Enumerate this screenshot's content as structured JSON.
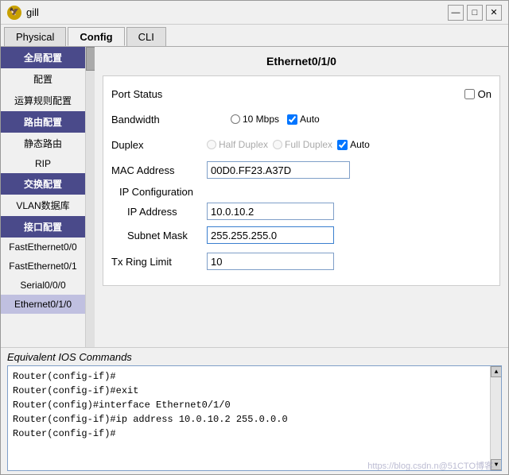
{
  "window": {
    "title": "gill",
    "icon": "🦅"
  },
  "title_buttons": {
    "minimize": "—",
    "maximize": "□",
    "close": "✕"
  },
  "tabs": [
    {
      "label": "Physical",
      "active": false
    },
    {
      "label": "Config",
      "active": true
    },
    {
      "label": "CLI",
      "active": false
    }
  ],
  "sidebar": {
    "items": [
      {
        "label": "全局配置",
        "type": "category"
      },
      {
        "label": "配置",
        "type": "normal"
      },
      {
        "label": "运算规则配置",
        "type": "normal"
      },
      {
        "label": "路由配置",
        "type": "category"
      },
      {
        "label": "静态路由",
        "type": "normal"
      },
      {
        "label": "RIP",
        "type": "normal"
      },
      {
        "label": "交换配置",
        "type": "category"
      },
      {
        "label": "VLAN数据库",
        "type": "normal"
      },
      {
        "label": "接口配置",
        "type": "category"
      },
      {
        "label": "FastEthernet0/0",
        "type": "normal"
      },
      {
        "label": "FastEthernet0/1",
        "type": "normal"
      },
      {
        "label": "Serial0/0/0",
        "type": "normal"
      },
      {
        "label": "Ethernet0/1/0",
        "type": "selected"
      }
    ]
  },
  "interface": {
    "title": "Ethernet0/1/0",
    "port_status": {
      "label": "Port Status",
      "checkbox_label": "On",
      "checked": false
    },
    "bandwidth": {
      "label": "Bandwidth",
      "option1_label": "10 Mbps",
      "option2_label": "Auto",
      "option1_checked": false,
      "option2_checked": true
    },
    "duplex": {
      "label": "Duplex",
      "half_label": "Half Duplex",
      "full_label": "Full Duplex",
      "auto_label": "Auto",
      "auto_checked": true
    },
    "mac_address": {
      "label": "MAC Address",
      "value": "00D0.FF23.A37D"
    },
    "ip_config": {
      "section_label": "IP Configuration",
      "ip_address": {
        "label": "IP Address",
        "value": "10.0.10.2"
      },
      "subnet_mask": {
        "label": "Subnet Mask",
        "value": "255.255.255.0"
      }
    },
    "tx_ring_limit": {
      "label": "Tx Ring Limit",
      "value": "10"
    }
  },
  "bottom": {
    "label": "Equivalent IOS Commands",
    "console_lines": [
      "Router(config-if)#",
      "Router(config-if)#exit",
      "Router(config)#interface Ethernet0/1/0",
      "Router(config-if)#ip address 10.0.10.2 255.0.0.0",
      "Router(config-if)#"
    ]
  },
  "watermark": "https://blog.csdn.n@51CTO博客"
}
